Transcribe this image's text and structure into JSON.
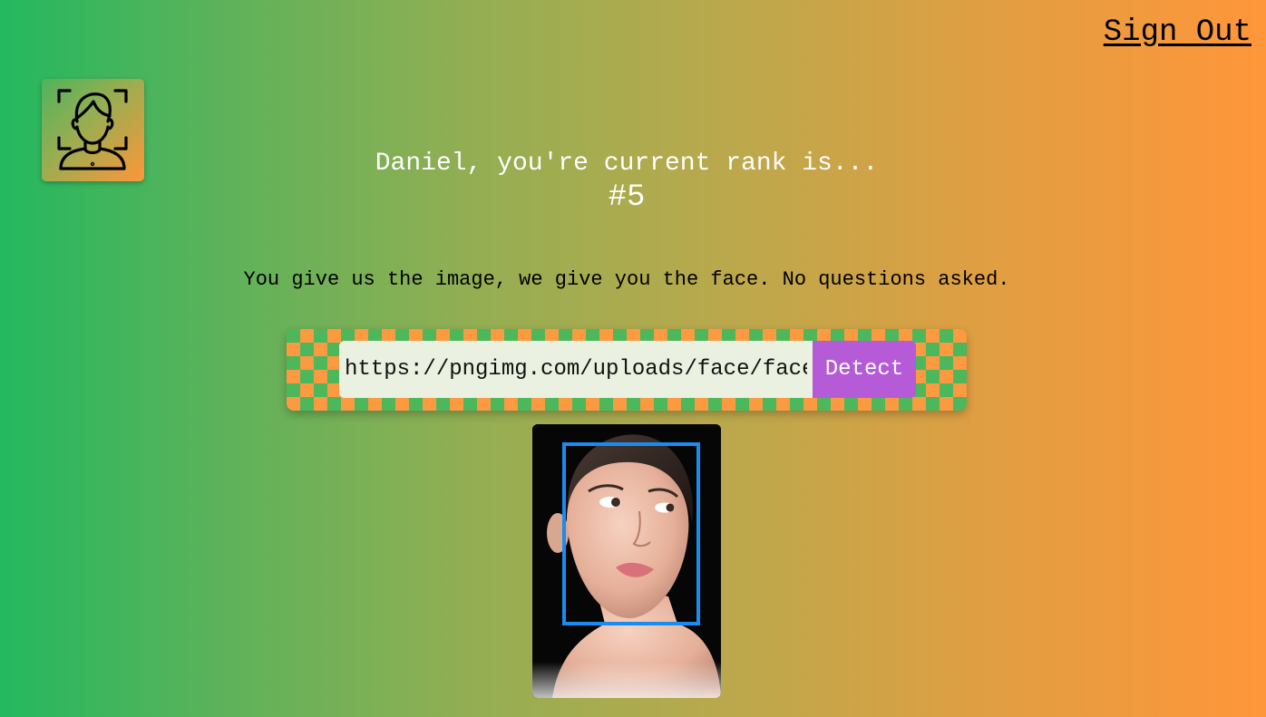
{
  "header": {
    "sign_out_label": "Sign Out"
  },
  "logo": {
    "icon": "face-scan-icon"
  },
  "rank": {
    "message": "Daniel, you're current rank is...",
    "value": "#5"
  },
  "tagline": "You give us the image, we give you the face. No questions asked.",
  "form": {
    "url_value": "https://pngimg.com/uploads/face/face",
    "detect_label": "Detect"
  },
  "result": {
    "image_icon": "portrait-photo",
    "face_box_icon": "face-bounding-box",
    "colors": {
      "box": "#1a8cf0",
      "button": "#b55bd8",
      "checker_green": "#4cb85b",
      "checker_orange": "#fb9a40"
    }
  }
}
